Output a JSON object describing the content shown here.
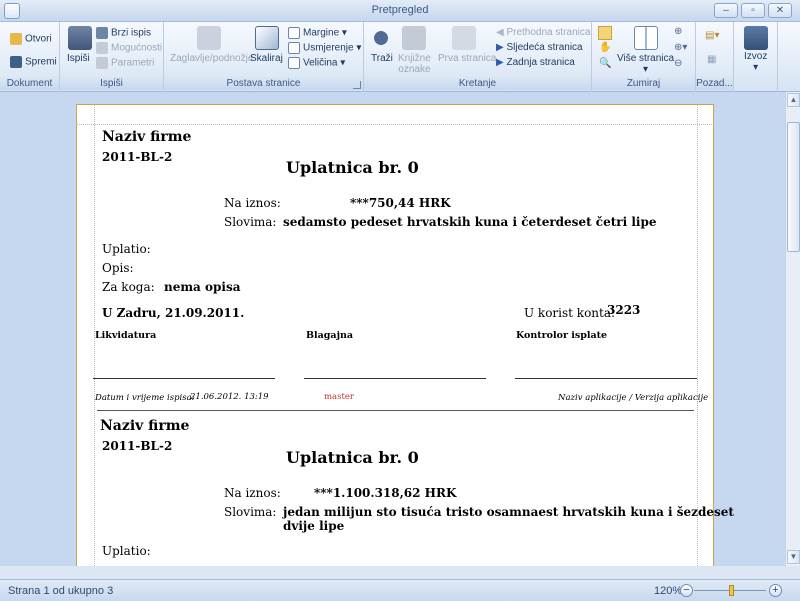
{
  "window": {
    "title": "Pretpregled"
  },
  "ribbon": {
    "dokument": {
      "label": "Dokument",
      "otvori": "Otvori",
      "spremi": "Spremi"
    },
    "ispisi": {
      "label": "Ispiši",
      "ispisi_big": "Ispiši",
      "brzi": "Brzi ispis",
      "mogucnosti": "Mogućnosti",
      "parametri": "Parametri"
    },
    "postava": {
      "label": "Postava stranice",
      "zaglavlje": "Zaglavlje/podnožje",
      "skaliraj": "Skaliraj",
      "margine": "Margine",
      "usmjerenje": "Usmjerenje",
      "velicina": "Veličina"
    },
    "kretanje": {
      "label": "Kretanje",
      "trazi": "Traži",
      "knjizne": "Knjižne",
      "oznake": "oznake",
      "prva": "Prva stranica",
      "prethodna": "Prethodna stranica",
      "sljedeca": "Sljedeća stranica",
      "zadnja": "Zadnja stranica"
    },
    "zumiraj": {
      "label": "Zumiraj",
      "vise": "Više stranica"
    },
    "pozad": {
      "label": "Pozad..."
    },
    "izvoz": {
      "label": "Izvoz"
    }
  },
  "slip1": {
    "firm": "Naziv firme",
    "code": "2011-BL-2",
    "title": "Uplatnica br. 0",
    "iznos_label": "Na iznos:",
    "iznos_value": "***750,44 HRK",
    "slovima_label": "Slovima:",
    "slovima_value": "sedamsto pedeset hrvatskih kuna i četerdeset četri lipe",
    "uplatio": "Uplatio:",
    "opis": "Opis:",
    "za_koga_label": "Za koga:",
    "za_koga_value": "nema opisa",
    "place_date": "U Zadru, 21.09.2011.",
    "konto_label": "U korist konta:",
    "konto_value": "3223",
    "sig1": "Likvidatura",
    "sig2": "Blagajna",
    "sig3": "Kontrolor isplate",
    "footer_label": "Datum i vrijeme ispisa:",
    "footer_date": "21.06.2012. 13:19",
    "footer_user": "master",
    "footer_app": "Naziv aplikacije / Verzija aplikacije"
  },
  "slip2": {
    "firm": "Naziv firme",
    "code": "2011-BL-2",
    "title": "Uplatnica br. 0",
    "iznos_label": "Na iznos:",
    "iznos_value": "***1.100.318,62 HRK",
    "slovima_label": "Slovima:",
    "slovima_line1": "jedan milijun sto tisuća tristo osamnaest hrvatskih kuna i šezdeset",
    "slovima_line2": "dvije lipe",
    "uplatio": "Uplatio:"
  },
  "status": {
    "pages": "Strana 1 od ukupno 3",
    "zoom": "120%"
  },
  "colors": {
    "footer_user": "#c0392b",
    "accent": "#f2c744"
  }
}
